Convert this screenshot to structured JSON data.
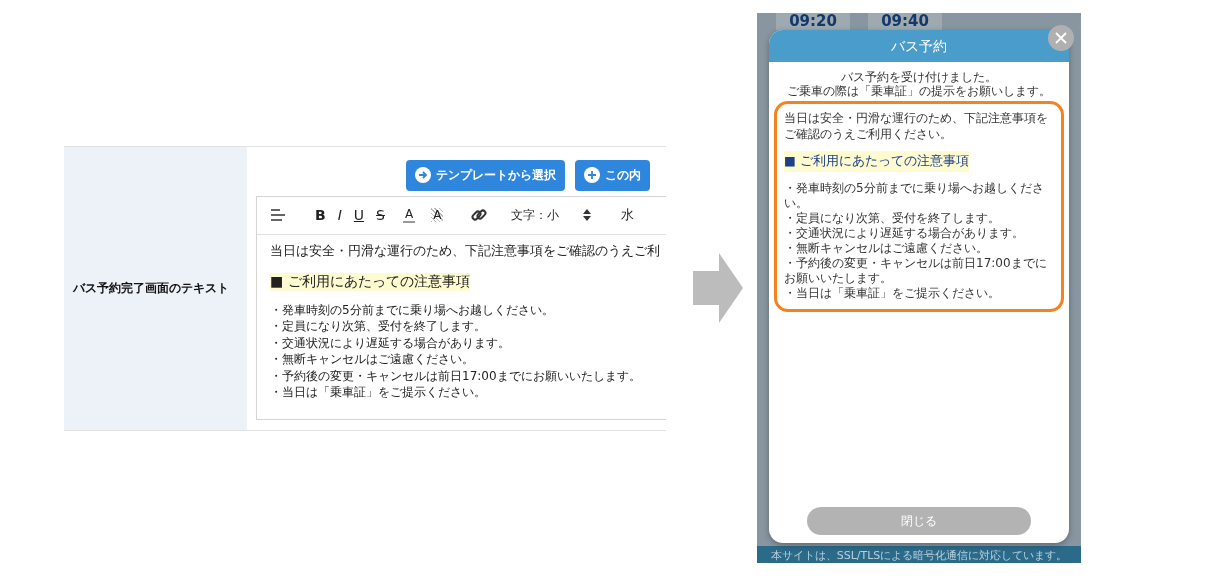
{
  "settings_row": {
    "label": "バス予約完了画面のテキスト",
    "buttons": [
      {
        "kind": "arrow",
        "label": "テンプレートから選択"
      },
      {
        "kind": "plus",
        "label": "この内"
      }
    ],
    "toolbar": [
      {
        "kind": "align"
      },
      {
        "kind": "bold",
        "label": "B"
      },
      {
        "kind": "italic",
        "label": "I"
      },
      {
        "kind": "underline",
        "label": "U"
      },
      {
        "kind": "strike",
        "label": "S"
      },
      {
        "kind": "color",
        "label": "A"
      },
      {
        "kind": "highlight",
        "label": "A"
      },
      {
        "kind": "link"
      },
      {
        "kind": "select",
        "label": "文字：小"
      },
      {
        "kind": "text",
        "label": "水"
      }
    ],
    "editor": {
      "intro": "当日は安全・円滑な運行のため、下記注意事項をご確認のうえご利",
      "heading": "■ ご利用にあたっての注意事項",
      "items": [
        "・発車時刻の5分前までに乗り場へお越しください。",
        "・定員になり次第、受付を終了します。",
        "・交通状況により遅延する場合があります。",
        "・無断キャンセルはご遠慮ください。",
        "・予約後の変更・キャンセルは前日17:00までにお願いいたします。",
        "・当日は「乗車証」をご提示ください。"
      ]
    }
  },
  "phone": {
    "time_slots": [
      "09:20",
      "09:40"
    ],
    "modal": {
      "title": "バス予約",
      "message": [
        "バス予約を受け付けました。",
        "ご乗車の際は「乗車証」の提示をお願いします。"
      ],
      "notice": {
        "intro": "当日は安全・円滑な運行のため、下記注意事項をご確認のうえご利用ください。",
        "heading": "■ ご利用にあたっての注意事項",
        "items": [
          "・発車時刻の5分前までに乗り場へお越しください。",
          "・定員になり次第、受付を終了します。",
          "・交通状況により遅延する場合があります。",
          "・無断キャンセルはご遠慮ください。",
          "・予約後の変更・キャンセルは前日17:00までにお願いいたします。",
          "・当日は「乗車証」をご提示ください。"
        ]
      },
      "close_button": {
        "label": "閉じる",
        "disabled": true
      }
    },
    "footer": "本サイトは、SSL/TLSによる暗号化通信に対応しています。"
  }
}
